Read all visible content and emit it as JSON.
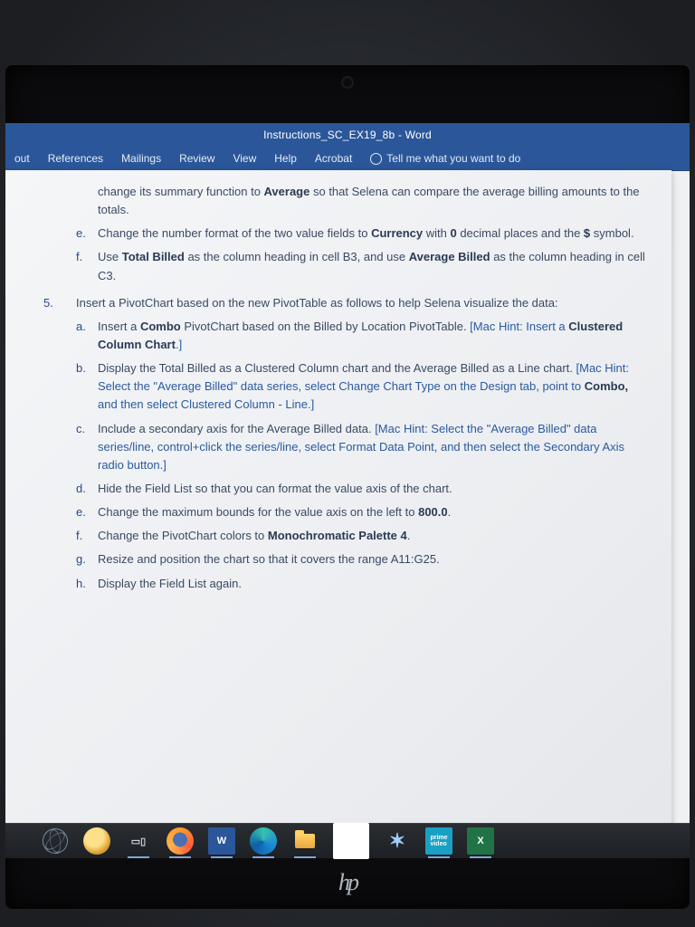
{
  "window": {
    "title": "Instructions_SC_EX19_8b - Word"
  },
  "ribbon": {
    "tabs": [
      "out",
      "References",
      "Mailings",
      "Review",
      "View",
      "Help",
      "Acrobat"
    ],
    "tellme": "Tell me what you want to do"
  },
  "doc": {
    "pre_text": "change its summary function to ",
    "pre_bold": "Average",
    "pre_text2": " so that Selena can compare the average billing amounts to the totals.",
    "e": {
      "t1": "Change the number format of the two value fields to ",
      "b1": "Currency",
      "t2": " with ",
      "b2": "0",
      "t3": " decimal places and the ",
      "b3": "$",
      "t4": " symbol."
    },
    "f": {
      "t1": "Use ",
      "b1": "Total Billed",
      "t2": " as the column heading in cell B3, and use ",
      "b2": "Average Billed",
      "t3": " as the column heading in cell C3."
    },
    "step5_num": "5.",
    "step5_text": "Insert a PivotChart based on the new PivotTable as follows to help Selena visualize the data:",
    "a": {
      "t1": "Insert a ",
      "b1": "Combo",
      "t2": " PivotChart based on the Billed by Location PivotTable. ",
      "h_open": "[Mac Hint: Insert a ",
      "hb": "Clustered Column Chart",
      "h_close": ".]"
    },
    "b": {
      "t1": "Display the Total Billed as a Clustered Column chart and the Average Billed as a Line chart. ",
      "h1": "[Mac Hint: Select the \"Average Billed\" data series, select Change Chart Type on the Design tab, point to ",
      "hb": "Combo,",
      "h2": " and then select Clustered Column - Line.]"
    },
    "c": {
      "t1": "Include a secondary axis for the Average Billed data. ",
      "h": "[Mac Hint: Select the \"Average Billed\" data series/line, control+click the series/line, select Format Data Point, and then select the Secondary Axis radio button.]"
    },
    "d": "Hide the Field List so that you can format the value axis of the chart.",
    "e2": {
      "t1": "Change the maximum bounds for the value axis on the left to ",
      "b1": "800.0",
      "t2": "."
    },
    "f2": {
      "t1": "Change the PivotChart colors to ",
      "b1": "Monochromatic Palette 4",
      "t2": "."
    },
    "g": "Resize and position the chart so that it covers the range A11:G25.",
    "h2": "Display the Field List again."
  },
  "taskbar": {
    "items": [
      "atom",
      "mascot",
      "task-view",
      "firefox",
      "word",
      "edge",
      "file-explorer",
      "ms-store",
      "settings-star",
      "prime-video",
      "excel"
    ]
  },
  "labels": {
    "e": "e.",
    "f": "f.",
    "a": "a.",
    "b": "b.",
    "c": "c.",
    "d": "d.",
    "g": "g.",
    "h": "h."
  }
}
